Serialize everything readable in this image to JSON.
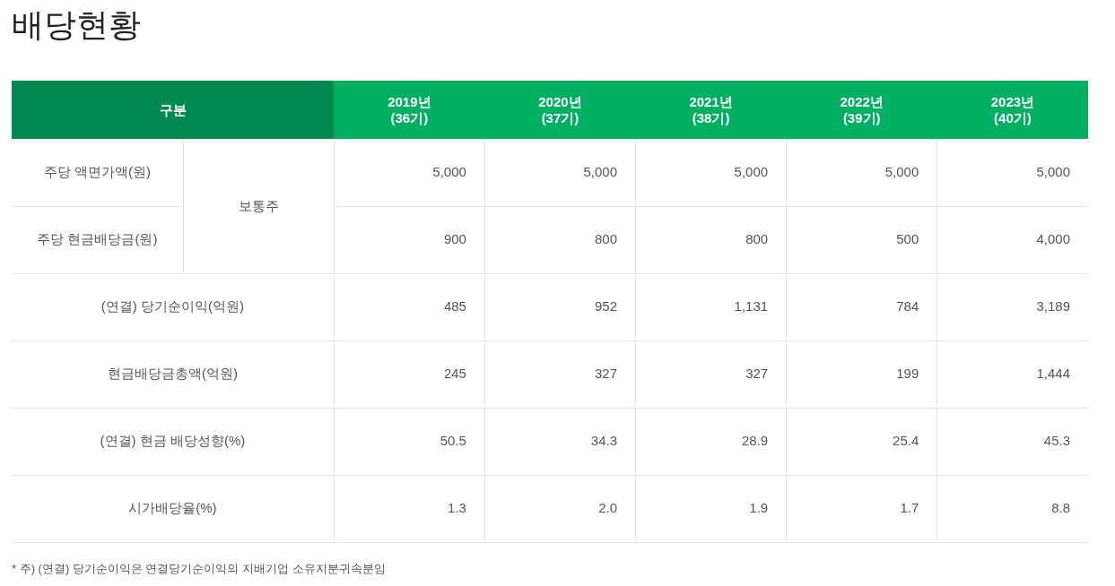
{
  "title": "배당현황",
  "table": {
    "columns": [
      {
        "year": "구분"
      },
      {
        "year": "2019년",
        "period": "(36기)"
      },
      {
        "year": "2020년",
        "period": "(37기)"
      },
      {
        "year": "2021년",
        "period": "(38기)"
      },
      {
        "year": "2022년",
        "period": "(39기)"
      },
      {
        "year": "2023년",
        "period": "(40기)"
      }
    ],
    "rows": [
      {
        "kind": "group",
        "label": "보통주",
        "rows": [
          {
            "label": "주당 액면가액(원)",
            "cells": [
              "5,000",
              "5,000",
              "5,000",
              "5,000",
              "5,000"
            ]
          },
          {
            "label": "주당 현금배당금(원)",
            "cells": [
              "900",
              "800",
              "800",
              "500",
              "4,000"
            ]
          }
        ]
      },
      {
        "kind": "row",
        "label": "(연결) 당기순이익(억원)",
        "cells": [
          "485",
          "952",
          "1,131",
          "784",
          "3,189"
        ]
      },
      {
        "kind": "row",
        "label": "현금배당금총액(억원)",
        "cells": [
          "245",
          "327",
          "327",
          "199",
          "1,444"
        ]
      },
      {
        "kind": "row",
        "label": "(연결) 현금 배당성향(%)",
        "cells": [
          "50.5",
          "34.3",
          "28.9",
          "25.4",
          "45.3"
        ]
      },
      {
        "kind": "row",
        "label": "시가배당율(%)",
        "cells": [
          "1.3",
          "2.0",
          "1.9",
          "1.7",
          "8.8"
        ]
      }
    ]
  },
  "footnote": "* 주) (연결) 당기순이익은 연결당기순이익의 지배기업 소유지분귀속분임"
}
